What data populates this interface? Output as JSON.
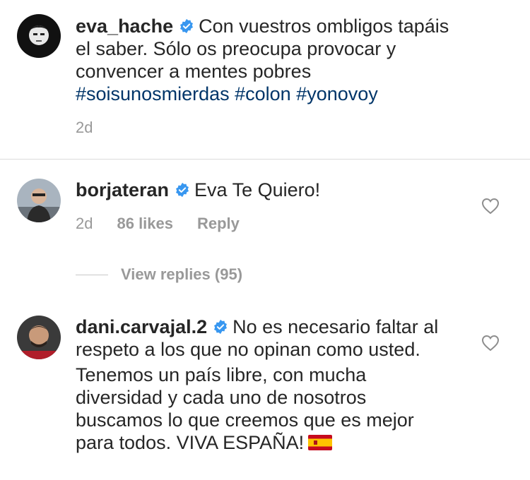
{
  "comments": [
    {
      "username": "eva_hache",
      "verified": true,
      "text": "Con vuestros ombligos tapáis el saber. Sólo os preocupa provocar y convencer a mentes pobres",
      "hashtags": [
        "#soisunosmierdas",
        "#colon",
        "#yonovoy"
      ],
      "time": "2d",
      "avatar_icon": "avatar-eva-hache"
    },
    {
      "username": "borjateran",
      "verified": true,
      "text": "Eva Te Quiero!",
      "time": "2d",
      "likes": "86 likes",
      "reply_label": "Reply",
      "avatar_icon": "avatar-borjateran",
      "like_icon": "heart-outline-icon"
    },
    {
      "username": "dani.carvajal.2",
      "verified": true,
      "text_line1": "No es necesario faltar al respeto a los que no opinan como usted.",
      "text_line2": "Tenemos un país libre, con mucha diversidad y cada uno de nosotros buscamos lo que creemos que es mejor para todos. VIVA ESPAÑA!",
      "emoji": "spain-flag-icon",
      "avatar_icon": "avatar-dani-carvajal",
      "like_icon": "heart-outline-icon"
    }
  ],
  "view_replies": "View replies (95)",
  "colors": {
    "text": "#262626",
    "muted": "#999999",
    "hashtag": "#003569",
    "verified": "#3897f0",
    "divider": "#dbdbdb"
  }
}
